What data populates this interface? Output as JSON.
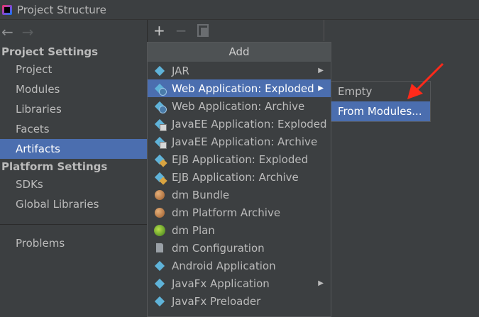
{
  "window": {
    "title": "Project Structure"
  },
  "sidebar": {
    "back_glyph": "←",
    "forward_glyph": "→",
    "project_settings_title": "Project Settings",
    "project_settings_items": [
      "Project",
      "Modules",
      "Libraries",
      "Facets",
      "Artifacts"
    ],
    "selected_item": "Artifacts",
    "platform_settings_title": "Platform Settings",
    "platform_settings_items": [
      "SDKs",
      "Global Libraries"
    ],
    "problems_label": "Problems"
  },
  "toolbar": {
    "add_glyph": "+",
    "remove_glyph": "−"
  },
  "add_menu": {
    "header": "Add",
    "items": [
      {
        "label": "JAR",
        "icon": "diamond-icon",
        "has_submenu": true
      },
      {
        "label": "Web Application: Exploded",
        "icon": "web-diamond-icon",
        "has_submenu": true,
        "highlighted": true
      },
      {
        "label": "Web Application: Archive",
        "icon": "web-diamond-icon",
        "has_submenu": false
      },
      {
        "label": "JavaEE Application: Exploded",
        "icon": "javaee-icon",
        "has_submenu": false
      },
      {
        "label": "JavaEE Application: Archive",
        "icon": "javaee-icon",
        "has_submenu": false
      },
      {
        "label": "EJB Application: Exploded",
        "icon": "ejb-icon",
        "has_submenu": false
      },
      {
        "label": "EJB Application: Archive",
        "icon": "ejb-icon",
        "has_submenu": false
      },
      {
        "label": "dm Bundle",
        "icon": "bundle-icon",
        "has_submenu": false
      },
      {
        "label": "dm Platform Archive",
        "icon": "bundle-icon",
        "has_submenu": false
      },
      {
        "label": "dm Plan",
        "icon": "plan-icon",
        "has_submenu": false
      },
      {
        "label": "dm Configuration",
        "icon": "document-icon",
        "has_submenu": false
      },
      {
        "label": "Android Application",
        "icon": "diamond-icon",
        "has_submenu": false
      },
      {
        "label": "JavaFx Application",
        "icon": "diamond-icon",
        "has_submenu": true
      },
      {
        "label": "JavaFx Preloader",
        "icon": "diamond-icon",
        "has_submenu": false
      }
    ]
  },
  "submenu": {
    "items": [
      {
        "label": "Empty",
        "highlighted": false
      },
      {
        "label": "From Modules...",
        "highlighted": true
      }
    ]
  },
  "colors": {
    "selection": "#4b6eaf",
    "background": "#3c3f41",
    "annotation_arrow": "#ff2a1a"
  }
}
